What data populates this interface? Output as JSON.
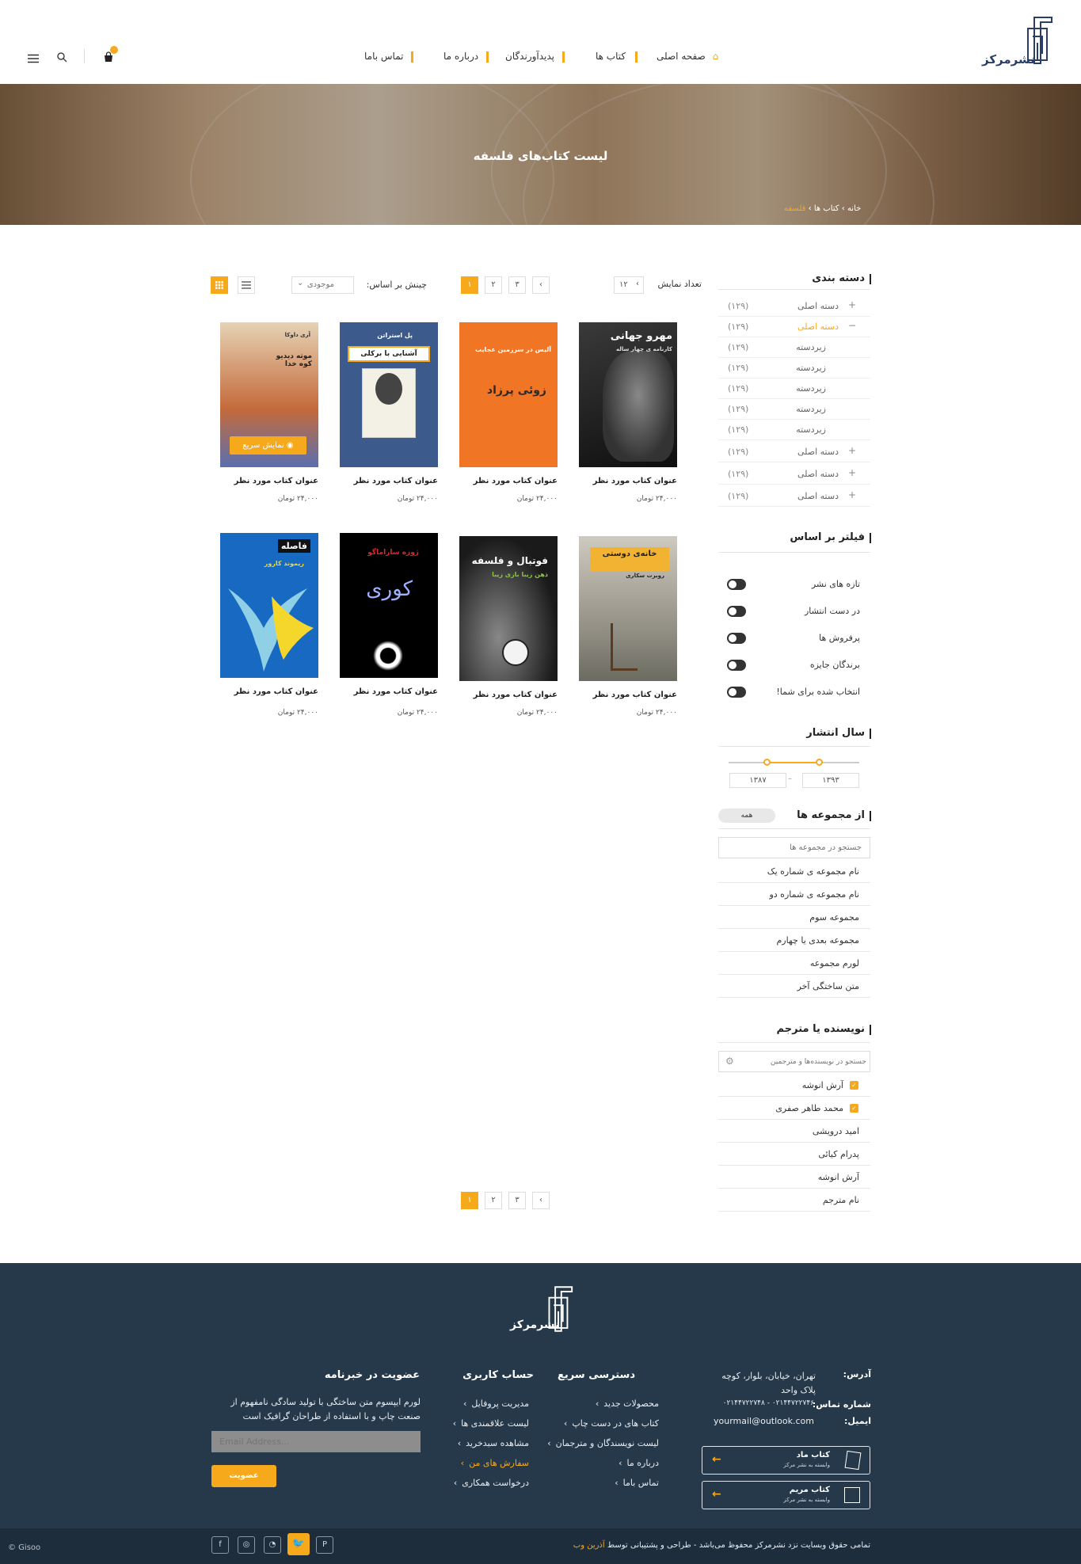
{
  "header": {
    "logo_text": "نشرمرکز",
    "cart_count": "۰",
    "nav": [
      "صفحه اصلی",
      "کتاب ها",
      "پدیدآورندگان",
      "درباره ما",
      "تماس باما"
    ]
  },
  "hero": {
    "title": "لیست کتاب‌های فلسفه",
    "breadcrumb": [
      "خانه",
      "کتاب ها",
      "فلسفه"
    ]
  },
  "sidebar": {
    "categories_title": "دسته بندی",
    "categories": [
      {
        "label": "دسته اصلی",
        "count": "(۱۲۹)",
        "sign": "+"
      },
      {
        "label": "دسته اصلی",
        "count": "(۱۲۹)",
        "sign": "−",
        "active": true
      },
      {
        "label": "زیردسته",
        "count": "(۱۲۹)",
        "sign": ""
      },
      {
        "label": "زیردسته",
        "count": "(۱۲۹)",
        "sign": ""
      },
      {
        "label": "زیردسته",
        "count": "(۱۲۹)",
        "sign": ""
      },
      {
        "label": "زیردسته",
        "count": "(۱۲۹)",
        "sign": ""
      },
      {
        "label": "زیردسته",
        "count": "(۱۲۹)",
        "sign": ""
      },
      {
        "label": "دسته اصلی",
        "count": "(۱۲۹)",
        "sign": "+"
      },
      {
        "label": "دسته اصلی",
        "count": "(۱۲۹)",
        "sign": "+"
      },
      {
        "label": "دسته اصلی",
        "count": "(۱۲۹)",
        "sign": "+"
      }
    ],
    "filter_title": "فیلتر بر اساس",
    "filters": [
      "تازه های نشر",
      "در دست انتشار",
      "پرفروش ها",
      "برندگان جایزه",
      "انتخاب شده برای شما!"
    ],
    "year_title": "سال انتشار",
    "year_from": "۱۳۹۳",
    "year_to": "۱۳۸۷",
    "year_range_fraction": [
      0.29,
      0.69
    ],
    "collections_title": "از مجموعه ها",
    "collections_all": "همه",
    "collections_search_placeholder": "جستجو در مجموعه ها",
    "collections": [
      "نام مجموعه ی شماره یک",
      "نام مجموعه ی شماره دو",
      "مجموعه سوم",
      "مجموعه بعدی یا چهارم",
      "لورم مجموعه",
      "متن ساختگی آخر"
    ],
    "authors_title": "نویسنده یا مترجم",
    "authors_search_placeholder": "جستجو در نویسنده‌ها و مترجمین",
    "authors": [
      {
        "name": "آرش انوشه",
        "checked": true
      },
      {
        "name": "محمد طاهر صفری",
        "checked": true
      },
      {
        "name": "امید درویشی",
        "checked": false
      },
      {
        "name": "پدرام کیائی",
        "checked": false
      },
      {
        "name": "آرش انوشه",
        "checked": false
      },
      {
        "name": "نام مترجم",
        "checked": false
      }
    ]
  },
  "toolbar": {
    "per_page_label": "تعداد نمایش",
    "per_page_value": "۱۲",
    "sort_label": "چینش بر اساس:",
    "sort_value": "موجودی",
    "pages": [
      "۱",
      "۲",
      "۳"
    ]
  },
  "products": [
    {
      "title": "عنوان کتاب مورد نظر",
      "price": "۲۴,۰۰۰ تومان",
      "cover_text": "مهرو جهانی",
      "cover_sub": "کارنامه ی چهار ساله"
    },
    {
      "title": "عنوان کتاب مورد نظر",
      "price": "۲۴,۰۰۰ تومان",
      "cover_text": "زوئی پرزاد",
      "cover_sub": "آلیس در سرزمین عجایب"
    },
    {
      "title": "عنوان کتاب مورد نظر",
      "price": "۲۴,۰۰۰ تومان",
      "cover_text": "آشنایی با برکلی",
      "cover_sub": "پل استراتن"
    },
    {
      "title": "عنوان کتاب مورد نظر",
      "price": "۲۴,۰۰۰ تومان",
      "cover_text": "موته دیدیو کوه خدا",
      "cover_sub": "آری داوکا",
      "quick_view": "نمایش سریع"
    },
    {
      "title": "عنوان کتاب مورد نظر",
      "price": "۲۴,۰۰۰ تومان",
      "cover_text": "خانه‌ی دوستی",
      "cover_sub": "روبرت سکاری"
    },
    {
      "title": "عنوان کتاب مورد نظر",
      "price": "۲۴,۰۰۰ تومان",
      "cover_text": "فوتبال و فلسفه",
      "cover_sub": "ذهن زیبا بازی زیبا"
    },
    {
      "title": "عنوان کتاب مورد نظر",
      "price": "۲۴,۰۰۰ تومان",
      "cover_text": "کوری",
      "cover_sub": "ژوزه ساراماگو"
    },
    {
      "title": "عنوان کتاب مورد نظر",
      "price": "۲۴,۰۰۰ تومان",
      "cover_text": "فاصله",
      "cover_sub": "ریموند کارور"
    }
  ],
  "pagination": [
    "۱",
    "۲",
    "۳"
  ],
  "footer": {
    "logo_text": "نشرمرکز",
    "address_label": "آدرس:",
    "address": "تهران، خیابان، بلوار، کوچه پلاک واحد",
    "phone_label": "شماره تماس:",
    "phone": "۰۲۱۴۴۷۲۲۷۴۸ - ۰۲۱۴۴۷۲۲۷۴۶",
    "email_label": "ایمیل:",
    "email": "yourmail@outlook.com",
    "brands": [
      {
        "name": "کتاب ماد",
        "sub": "وابسته به نشر مرکز"
      },
      {
        "name": "کتاب مریم",
        "sub": "وابسته به نشر مرکز"
      }
    ],
    "quick_title": "دسترسی سریع",
    "quick_links": [
      "محصولات جدید",
      "کتاب های در دست چاپ",
      "لیست نویسندگان و مترجمان",
      "درباره ما",
      "تماس باما"
    ],
    "account_title": "حساب کاربری",
    "account_links": [
      "مدیریت پروفایل",
      "لیست علاقمندی ها",
      "مشاهده سبدخرید",
      "سفارش های من",
      "درخواست همکاری"
    ],
    "newsletter_title": "عضویت در خبرنامه",
    "newsletter_text": "لورم ایپسوم متن ساختگی با تولید سادگی نامفهوم از صنعت چاپ و با استفاده از طراحان گرافیک است",
    "newsletter_placeholder": "Email Address...",
    "newsletter_button": "عضویت",
    "copyright": "تمامی حقوق وبسایت نزد نشرمرکز محفوظ می‌باشد - طراحی و پشتیبانی توسط",
    "designer": "آذرین وب",
    "credit": "© Gisoo"
  },
  "colors": {
    "accent": "#f7a91c",
    "footer_bg": "#26394b",
    "footer_bottom": "#1d2d3b"
  }
}
